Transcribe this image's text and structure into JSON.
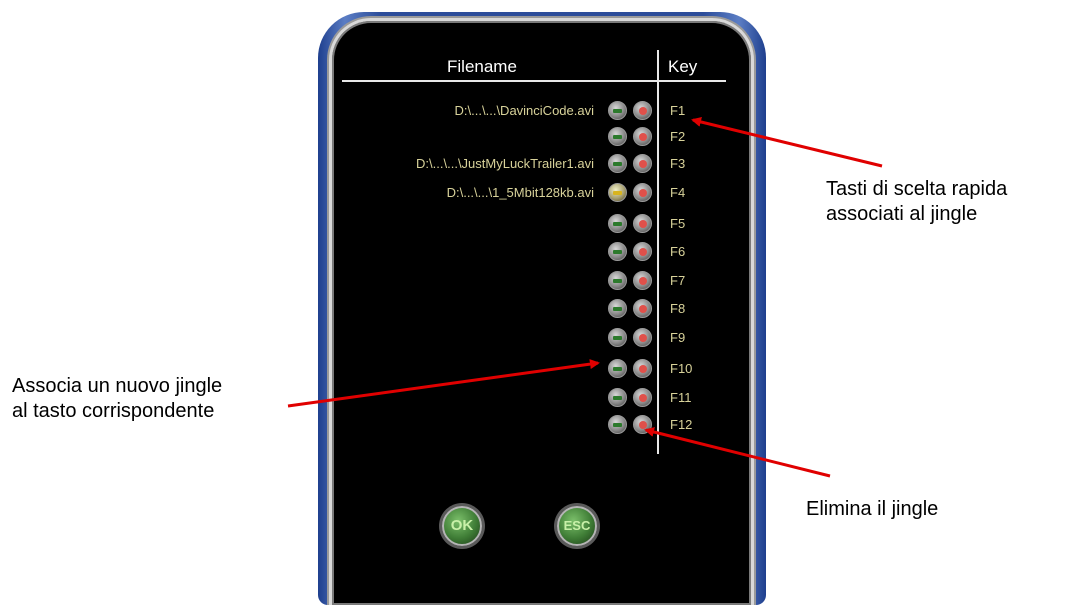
{
  "table": {
    "headers": {
      "filename": "Filename",
      "key": "Key"
    },
    "rows": [
      {
        "filename": "D:\\...\\...\\DavinciCode.avi",
        "key": "F1",
        "assigned": true
      },
      {
        "filename": "",
        "key": "F2",
        "assigned": false
      },
      {
        "filename": "D:\\...\\...\\JustMyLuckTrailer1.avi",
        "key": "F3",
        "assigned": true
      },
      {
        "filename": "D:\\...\\...\\1_5Mbit128kb.avi",
        "key": "F4",
        "assigned": true
      },
      {
        "filename": "",
        "key": "F5",
        "assigned": false
      },
      {
        "filename": "",
        "key": "F6",
        "assigned": false
      },
      {
        "filename": "",
        "key": "F7",
        "assigned": false
      },
      {
        "filename": "",
        "key": "F8",
        "assigned": false
      },
      {
        "filename": "",
        "key": "F9",
        "assigned": false
      },
      {
        "filename": "",
        "key": "F10",
        "assigned": false
      },
      {
        "filename": "",
        "key": "F11",
        "assigned": false
      },
      {
        "filename": "",
        "key": "F12",
        "assigned": false
      }
    ]
  },
  "buttons": {
    "ok_label": "OK",
    "esc_label": "ESC"
  },
  "annotations": {
    "keys_line1": "Tasti di scelta rapida",
    "keys_line2": "associati al jingle",
    "assoc_line1": "Associa un nuovo jingle",
    "assoc_line2": "al tasto corrispondente",
    "delete": "Elimina il jingle"
  },
  "colors": {
    "panel_background": "#000000",
    "text": "#d8d29a",
    "arrow": "#e00000",
    "frame": "#2c4d9a"
  }
}
